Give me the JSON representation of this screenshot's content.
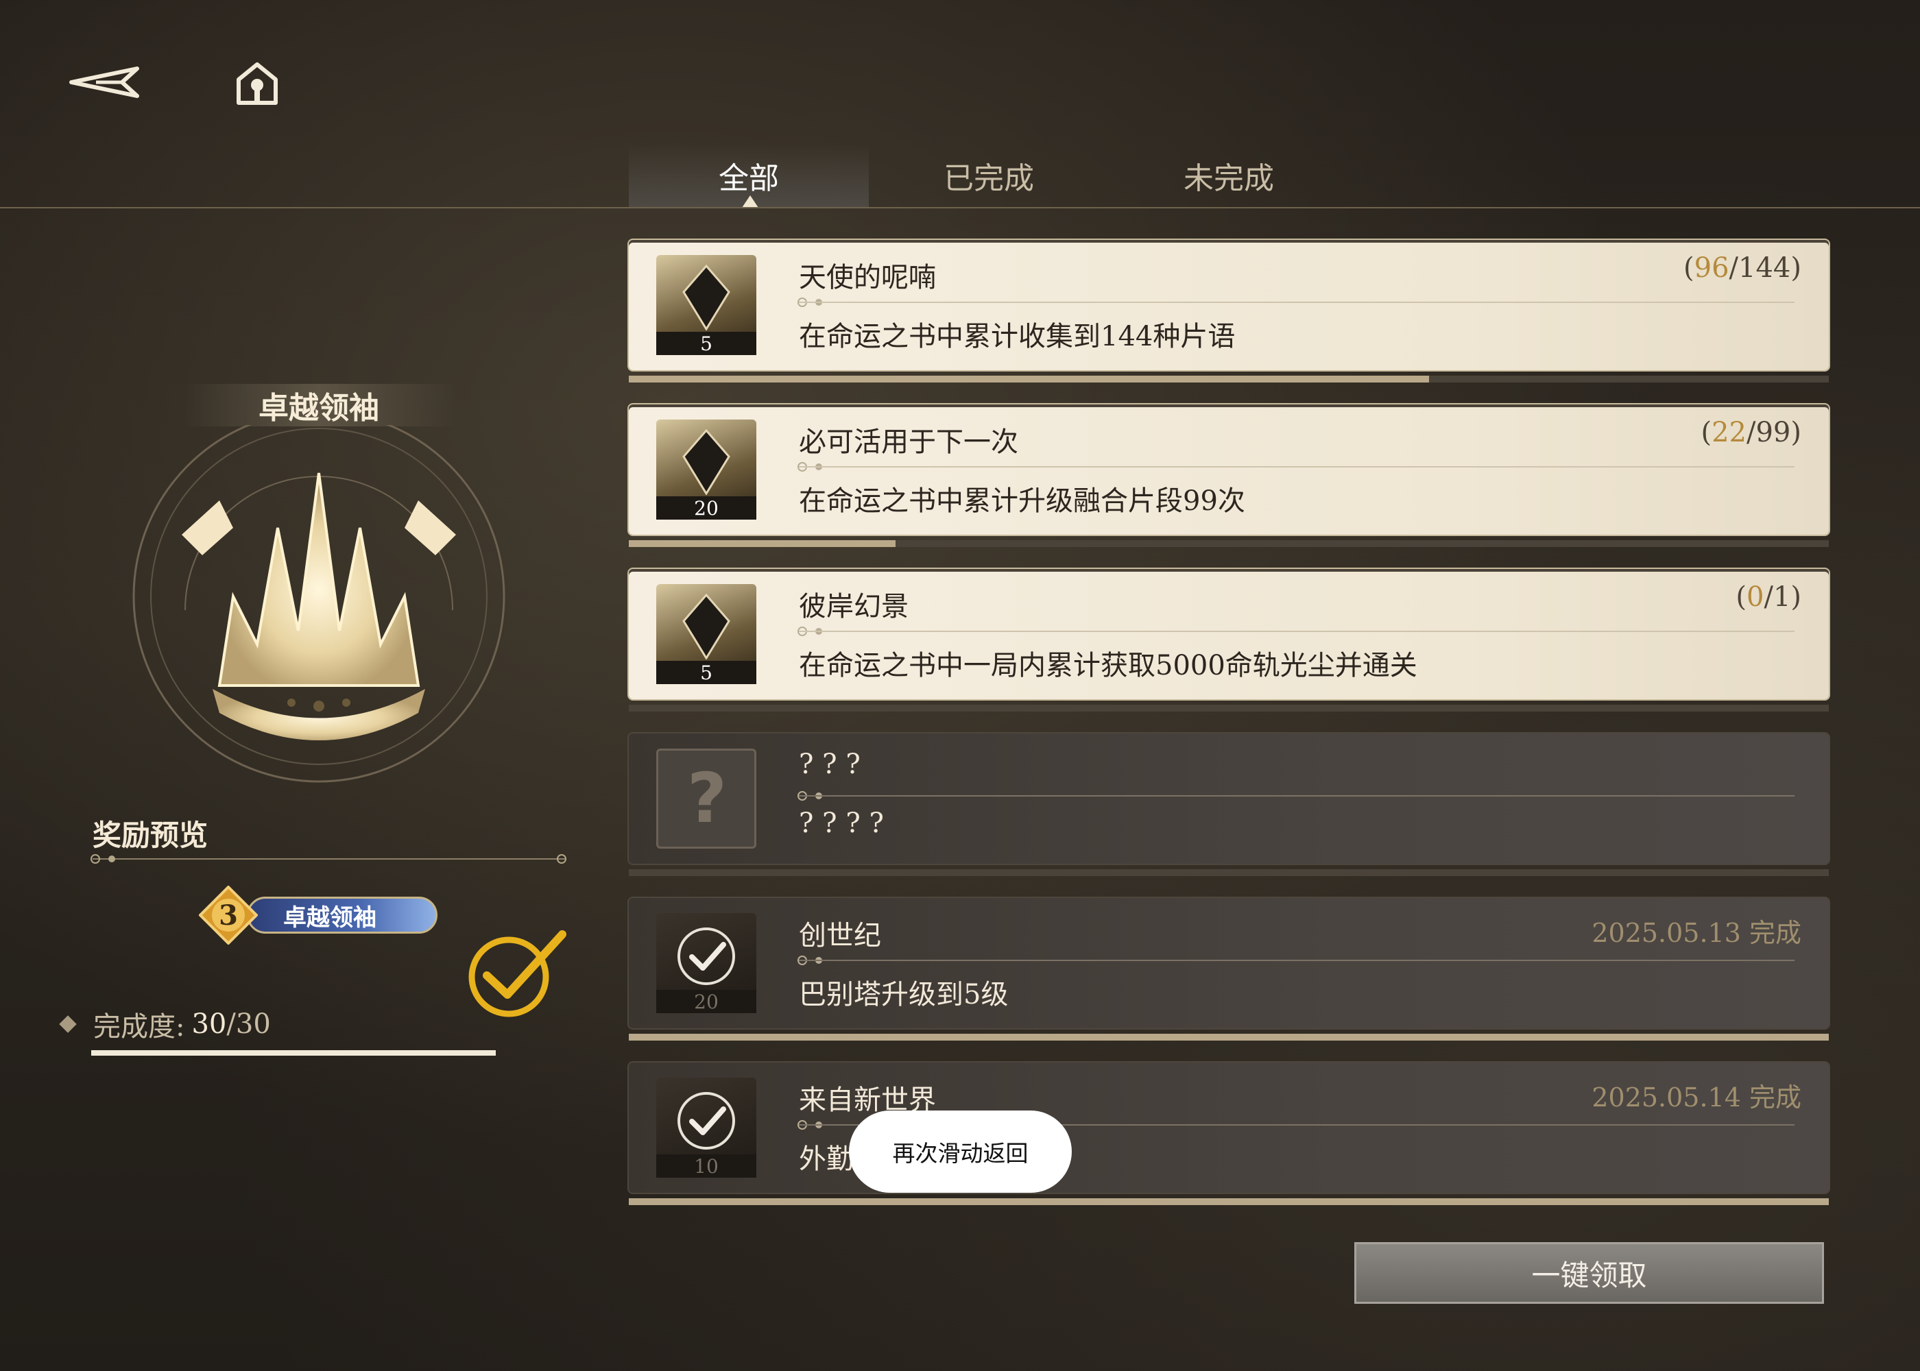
{
  "nav": {
    "back_icon": "back-arrow-icon",
    "home_icon": "home-icon"
  },
  "tabs": [
    {
      "label": "全部",
      "active": true
    },
    {
      "label": "已完成",
      "active": false
    },
    {
      "label": "未完成",
      "active": false
    }
  ],
  "left_panel": {
    "badge_name": "卓越领袖",
    "reward_preview_label": "奖励预览",
    "reward_title": {
      "level": "3",
      "name": "卓越领袖"
    },
    "completion_label": "完成度:",
    "completion_current": "30",
    "completion_total": "/30",
    "completed": true
  },
  "achievements": [
    {
      "title": "天使的呢喃",
      "desc": "在命运之书中累计收集到144种片语",
      "reward_count": "5",
      "progress_current": "96",
      "progress_total": "144",
      "fraction": 0.667,
      "state": "in_progress"
    },
    {
      "title": "必可活用于下一次",
      "desc": "在命运之书中累计升级融合片段99次",
      "reward_count": "20",
      "progress_current": "22",
      "progress_total": "99",
      "fraction": 0.222,
      "state": "in_progress"
    },
    {
      "title": "彼岸幻景",
      "desc": "在命运之书中一局内累计获取5000命轨光尘并通关",
      "reward_count": "5",
      "progress_current": "0",
      "progress_total": "1",
      "fraction": 0.0,
      "state": "in_progress"
    },
    {
      "title": "? ? ?",
      "desc": "? ? ? ?",
      "state": "hidden"
    },
    {
      "title": "创世纪",
      "desc": "巴别塔升级到5级",
      "reward_count": "20",
      "date": "2025.05.13 完成",
      "fraction": 1.0,
      "state": "completed"
    },
    {
      "title": "来自新世界",
      "desc": "外勤",
      "reward_count": "10",
      "date": "2025.05.14 完成",
      "fraction": 1.0,
      "state": "completed"
    }
  ],
  "claim_all_label": "一键领取",
  "toast": "再次滑动返回",
  "colors": {
    "accent_gold": "#b58a3c",
    "check_yellow": "#e8b21c",
    "card_light": "#f3ebdc",
    "card_dark": "#45403b"
  }
}
